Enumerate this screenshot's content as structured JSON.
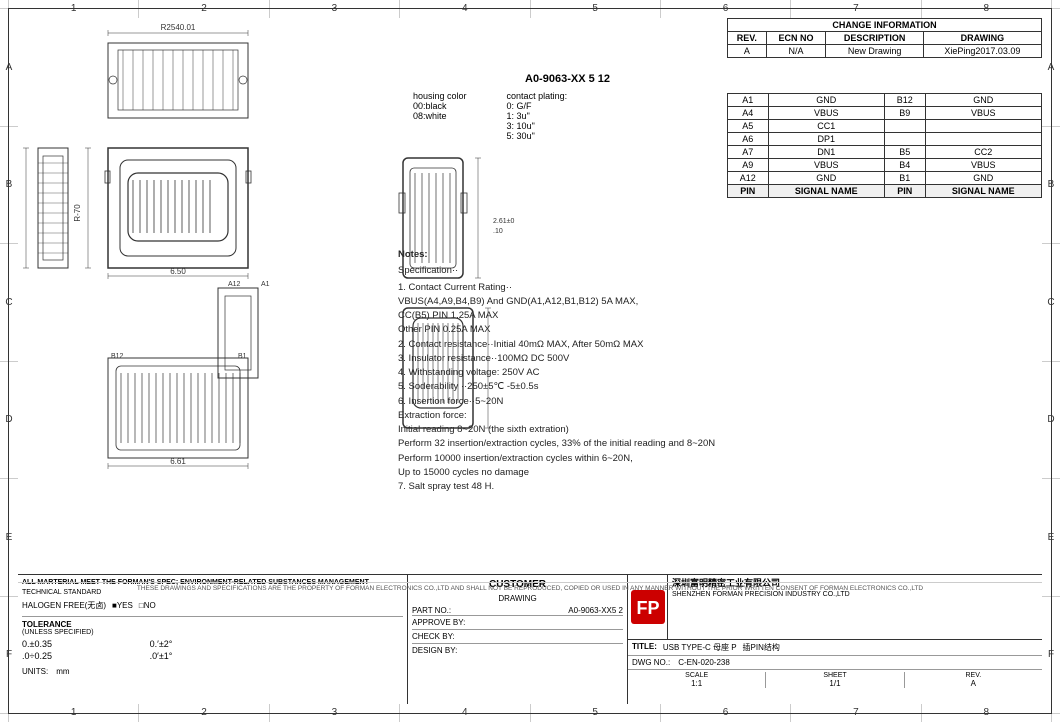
{
  "col_markers": [
    "1",
    "2",
    "3",
    "4",
    "5",
    "6",
    "7",
    "8"
  ],
  "row_markers": [
    "A",
    "B",
    "C",
    "D",
    "E",
    "F"
  ],
  "change_info": {
    "header": "CHANGE INFORMATION",
    "columns": [
      "REV.",
      "ECN NO",
      "DESCRIPTION",
      "DRAWING"
    ],
    "rows": [
      [
        "A",
        "N/A",
        "New Drawing",
        "XiePing2017.03.09"
      ]
    ]
  },
  "pin_table": {
    "headers": [
      "A1",
      "GND",
      "B12",
      "GND"
    ],
    "rows": [
      [
        "A4",
        "VBUS",
        "B9",
        "VBUS"
      ],
      [
        "A5",
        "CC1",
        "",
        ""
      ],
      [
        "A6",
        "DP1",
        "",
        ""
      ],
      [
        "A7",
        "DN1",
        "",
        ""
      ],
      [
        "",
        "",
        "B5",
        "CC2"
      ],
      [
        "A9",
        "VBUS",
        "B4",
        "VBUS"
      ],
      [
        "A12",
        "GND",
        "B1",
        "GND"
      ]
    ],
    "footer": [
      "PIN",
      "SIGNAL NAME",
      "PIN",
      "SIGNAL NAME"
    ]
  },
  "part_number": {
    "main": "A0-9063-XX 5 12",
    "housing_color_label": "housing color",
    "contact_plating_label": "contact plating:",
    "options_left": [
      "00:black",
      "08:white"
    ],
    "options_right": [
      "0: G/F",
      "1: 3u\"",
      "3: 10u\"",
      "5: 30u\""
    ]
  },
  "notes": {
    "title": "Notes:",
    "spec_title": "Specification··",
    "items": [
      "1. Contact Current Rating··",
      "   VBUS(A4,A9,B4,B9) And GND(A1,A12,B1,B12) 5A MAX,",
      "   CC(B5) PIN 1.25A MAX",
      "   Other PIN 0.25A MAX",
      "2. Contact resistance··Initial 40mΩ MAX, After 50mΩ MAX",
      "3. Insulator resistance··100MΩ  DC 500V",
      "4. Withstanding voltage: 250V AC",
      "5. Soderability ··250±5℃ -5±0.5s",
      "6. Insertion force··5~20N",
      "   Extraction force:",
      "   Initial reading 8~20N (the sixth extration)",
      "   Perform 32 insertion/extraction cycles, 33% of the initial reading and 8~20N",
      "   Perform 10000 insertion/extraction cycles within 6~20N,",
      "   Up to 15000 cycles no damage",
      "7. Salt spray test 48 H."
    ]
  },
  "bottom_block": {
    "env_text": "ALL MARTERIAL MEET THE FORMAN'S SPEC; ENVIRONMENT-RELATED SUBSTANCES MANAGEMENT",
    "tech_std": "TECHNICAL STANDARD",
    "halogen_free": "HALOGEN FREE(无卤)",
    "yes_label": "■YES",
    "no_label": "□NO",
    "unless": "(UNLESS SPECIFIED)",
    "tolerance_label": "TOLERANCE",
    "tolerances": [
      [
        "0.±0.35",
        "0.′±2°",
        ""
      ],
      [
        ".0÷0.25",
        ".0′±1°",
        ""
      ]
    ],
    "units_label": "UNITS:",
    "units_value": "mm",
    "customer_title": "CUSTOMER",
    "drawing_label": "DRAWING",
    "part_no_label": "PART NO.:",
    "part_no_value": "A0-9063-XX5 2",
    "approve_label": "APPROVE BY:",
    "check_label": "CHECK BY:",
    "design_label": "DESIGN BY:",
    "title_label": "TITLE:",
    "title_value": "USB TYPE-C 母座 P",
    "title_sub": "插PIN结构",
    "dwg_no_label": "DWG NO.:",
    "dwg_no_value": "C-EN-020-238",
    "scale_label": "SCALE",
    "scale_value": "1:1",
    "sheet_label": "SHEET",
    "sheet_value": "1/1",
    "rev_label": "REV.",
    "rev_value": "A",
    "company_name": "深圳富明精密工业有限公司",
    "company_name_en": "SHENZHEN FORMAN PRECISION INDUSTRY CO.,LTD",
    "footnote": "THESE DRAWINGS AND SPECIFICATIONS ARE THE PROPERTY OF FORMAN ELECTRONICS CO.,LTD AND SHALL NOT BE REPRODUCED, COPIED OR USED IN ANY MANNER WITHOUT THE PRIOR WRITTEN CONSENT OF FORMAN ELECTRONICS CO.,LTD"
  }
}
